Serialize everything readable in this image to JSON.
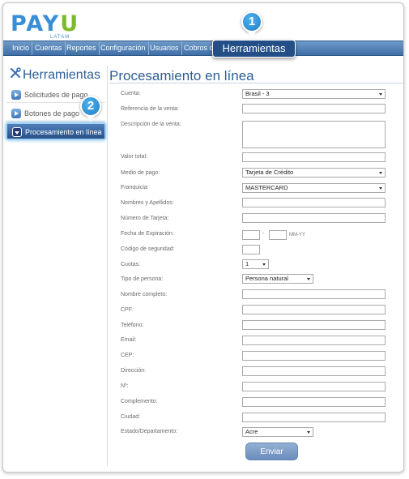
{
  "logo": {
    "text_main": "PAY",
    "text_accent": "U",
    "sub": "LATAM"
  },
  "nav": {
    "items": [
      "Inicio",
      "Cuentas",
      "Reportes",
      "Configuración",
      "Usuarios",
      "Cobros c"
    ],
    "callout_label": "Herramientas"
  },
  "badges": {
    "one": "1",
    "two": "2"
  },
  "sidebar": {
    "title": "Herramientas",
    "items": [
      {
        "label": "Solicitudes de pago"
      },
      {
        "label": "Botones de pago"
      },
      {
        "label": "Procesamiento en línea"
      }
    ]
  },
  "main": {
    "title": "Procesamiento en línea",
    "fields": {
      "cuenta": {
        "label": "Cuenta:",
        "value": "Brasil - 3"
      },
      "referencia": {
        "label": "Referencia de la venta:"
      },
      "descripcion": {
        "label": "Descripción de la venta:"
      },
      "valor": {
        "label": "Valor total:"
      },
      "medio": {
        "label": "Medio de pago:",
        "value": "Tarjeta de Crédito"
      },
      "franquicia": {
        "label": "Franquicia:",
        "value": "MASTERCARD"
      },
      "nombres": {
        "label": "Nombres y Apellidos:"
      },
      "numero": {
        "label": "Número de Tarjeta:"
      },
      "expiracion": {
        "label": "Fecha de Expiración:",
        "separator": "-",
        "hint": "MM-YY"
      },
      "codigo": {
        "label": "Código de seguridad:"
      },
      "cuotas": {
        "label": "Cuotas:",
        "value": "1"
      },
      "tipo_persona": {
        "label": "Tipo de persona:",
        "value": "Persona natural"
      },
      "nombre_completo": {
        "label": "Nombre completo:"
      },
      "cpf": {
        "label": "CPF:"
      },
      "telefono": {
        "label": "Teléfono:"
      },
      "email": {
        "label": "Email:"
      },
      "cep": {
        "label": "CEP:"
      },
      "direccion": {
        "label": "Dirección:"
      },
      "numero_dir": {
        "label": "Nº:"
      },
      "complemento": {
        "label": "Complemento:"
      },
      "ciudad": {
        "label": "Ciudad:"
      },
      "estado": {
        "label": "Estado/Departamento:",
        "value": "Acre"
      }
    },
    "submit_label": "Enviar"
  },
  "colors": {
    "brand_blue": "#3a8ed6",
    "brand_green": "#7dbb2a",
    "nav_blue": "#3f6fa7",
    "callout_navy": "#234f86",
    "badge_blue": "#1f7fc6"
  }
}
